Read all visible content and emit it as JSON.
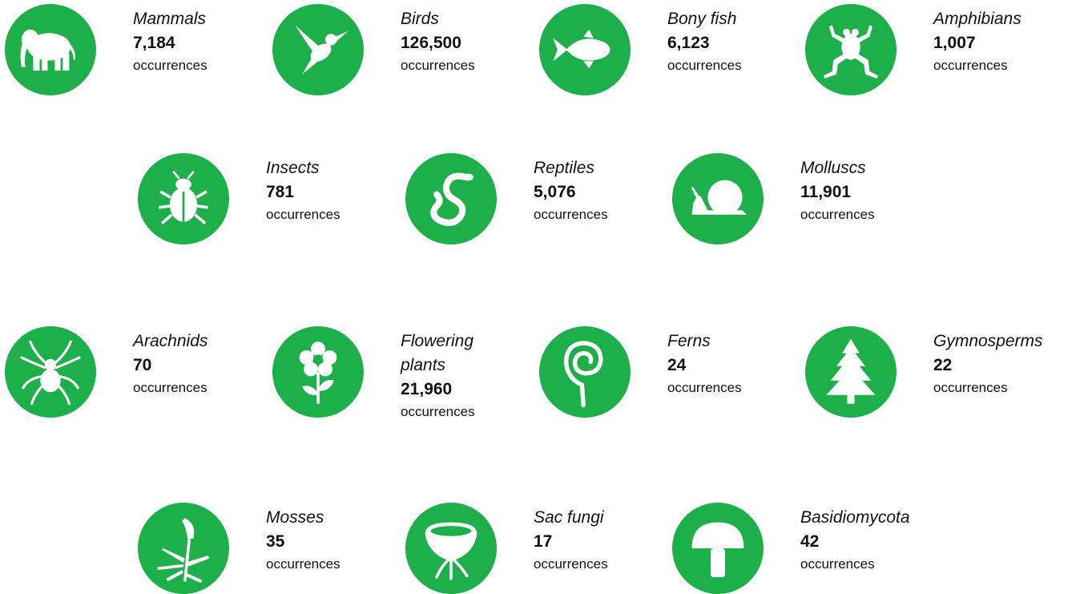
{
  "accent_color": "#1DAF49",
  "groups": [
    {
      "name": "Mammals",
      "count": "7,184",
      "unit": "occurrences",
      "icon": "elephant-icon"
    },
    {
      "name": "Birds",
      "count": "126,500",
      "unit": "occurrences",
      "icon": "hummingbird-icon"
    },
    {
      "name": "Bony fish",
      "count": "6,123",
      "unit": "occurrences",
      "icon": "fish-icon"
    },
    {
      "name": "Amphibians",
      "count": "1,007",
      "unit": "occurrences",
      "icon": "frog-icon"
    },
    {
      "name": "Insects",
      "count": "781",
      "unit": "occurrences",
      "icon": "beetle-icon"
    },
    {
      "name": "Reptiles",
      "count": "5,076",
      "unit": "occurrences",
      "icon": "snake-icon"
    },
    {
      "name": "Molluscs",
      "count": "11,901",
      "unit": "occurrences",
      "icon": "snail-icon"
    },
    {
      "name": "Arachnids",
      "count": "70",
      "unit": "occurrences",
      "icon": "spider-icon"
    },
    {
      "name": "Flowering plants",
      "count": "21,960",
      "unit": "occurrences",
      "icon": "flower-icon"
    },
    {
      "name": "Ferns",
      "count": "24",
      "unit": "occurrences",
      "icon": "fern-icon"
    },
    {
      "name": "Gymnosperms",
      "count": "22",
      "unit": "occurrences",
      "icon": "conifer-tree-icon"
    },
    {
      "name": "Mosses",
      "count": "35",
      "unit": "occurrences",
      "icon": "moss-icon"
    },
    {
      "name": "Sac fungi",
      "count": "17",
      "unit": "occurrences",
      "icon": "cup-fungus-icon"
    },
    {
      "name": "Basidiomycota",
      "count": "42",
      "unit": "occurrences",
      "icon": "mushroom-icon"
    }
  ]
}
